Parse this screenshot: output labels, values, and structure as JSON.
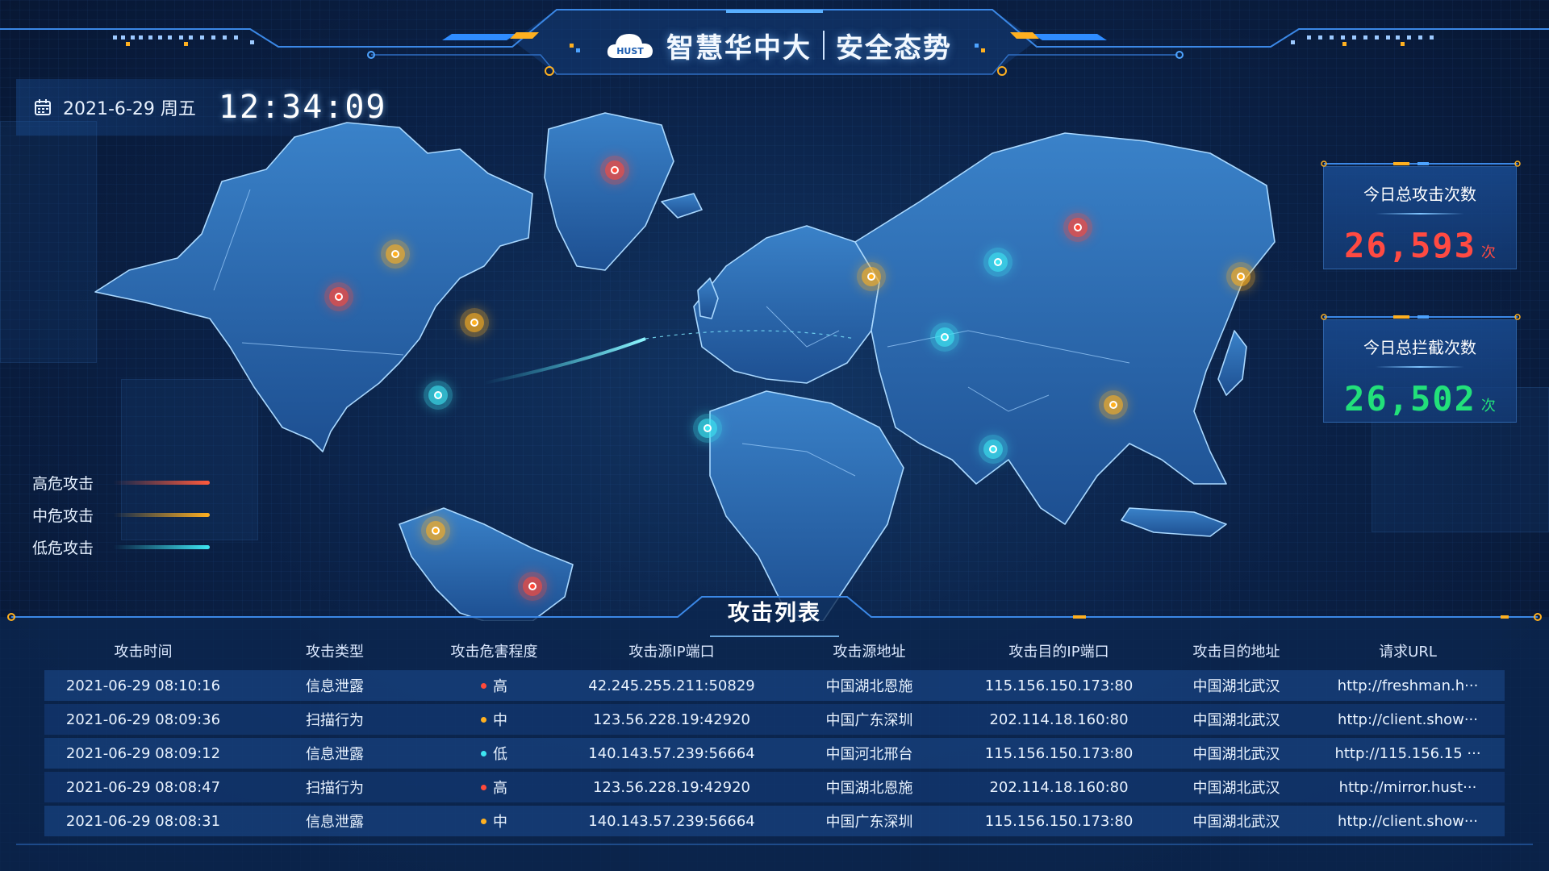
{
  "header": {
    "title_left": "智慧华中大",
    "title_right": "安全态势",
    "logo_text": "HUST"
  },
  "datetime": {
    "date": "2021-6-29 周五",
    "time": "12:34:09"
  },
  "legend": [
    {
      "label": "高危攻击",
      "color": "#ff5a3c"
    },
    {
      "label": "中危攻击",
      "color": "#ffb020"
    },
    {
      "label": "低危攻击",
      "color": "#3ee6f2"
    }
  ],
  "stats": [
    {
      "label": "今日总攻击次数",
      "value": "26,593",
      "unit": "次",
      "color": "#ff4a42"
    },
    {
      "label": "今日总拦截次数",
      "value": "26,502",
      "unit": "次",
      "color": "#22e07a"
    }
  ],
  "map": {
    "markers": [
      {
        "level": "high"
      },
      {
        "level": "high"
      },
      {
        "level": "high"
      },
      {
        "level": "high"
      },
      {
        "level": "mid"
      },
      {
        "level": "mid"
      },
      {
        "level": "mid"
      },
      {
        "level": "mid"
      },
      {
        "level": "mid"
      },
      {
        "level": "mid"
      },
      {
        "level": "low"
      },
      {
        "level": "low"
      },
      {
        "level": "low"
      },
      {
        "level": "low"
      },
      {
        "level": "low"
      }
    ]
  },
  "table": {
    "title": "攻击列表",
    "headers": [
      "攻击时间",
      "攻击类型",
      "攻击危害程度",
      "攻击源IP端口",
      "攻击源地址",
      "攻击目的IP端口",
      "攻击目的地址",
      "请求URL"
    ],
    "rows": [
      {
        "time": "2021-06-29 08:10:16",
        "type": "信息泄露",
        "severity": "高",
        "level": "high",
        "src_ip": "42.245.255.211:50829",
        "src_addr": "中国湖北恩施",
        "dst_ip": "115.156.150.173:80",
        "dst_addr": "中国湖北武汉",
        "url": "http://freshman.h···"
      },
      {
        "time": "2021-06-29 08:09:36",
        "type": "扫描行为",
        "severity": "中",
        "level": "mid",
        "src_ip": "123.56.228.19:42920",
        "src_addr": "中国广东深圳",
        "dst_ip": "202.114.18.160:80",
        "dst_addr": "中国湖北武汉",
        "url": "http://client.show···"
      },
      {
        "time": "2021-06-29 08:09:12",
        "type": "信息泄露",
        "severity": "低",
        "level": "low",
        "src_ip": "140.143.57.239:56664",
        "src_addr": "中国河北邢台",
        "dst_ip": "115.156.150.173:80",
        "dst_addr": "中国湖北武汉",
        "url": "http://115.156.15 ···"
      },
      {
        "time": "2021-06-29 08:08:47",
        "type": "扫描行为",
        "severity": "高",
        "level": "high",
        "src_ip": "123.56.228.19:42920",
        "src_addr": "中国湖北恩施",
        "dst_ip": "202.114.18.160:80",
        "dst_addr": "中国湖北武汉",
        "url": "http://mirror.hust···"
      },
      {
        "time": "2021-06-29 08:08:31",
        "type": "信息泄露",
        "severity": "中",
        "level": "mid",
        "src_ip": "140.143.57.239:56664",
        "src_addr": "中国广东深圳",
        "dst_ip": "115.156.150.173:80",
        "dst_addr": "中国湖北武汉",
        "url": "http://client.show···"
      }
    ]
  },
  "colors": {
    "high": "#ff4a3a",
    "mid": "#ffb020",
    "low": "#3ee6f2",
    "accent": "#2f8cff"
  }
}
